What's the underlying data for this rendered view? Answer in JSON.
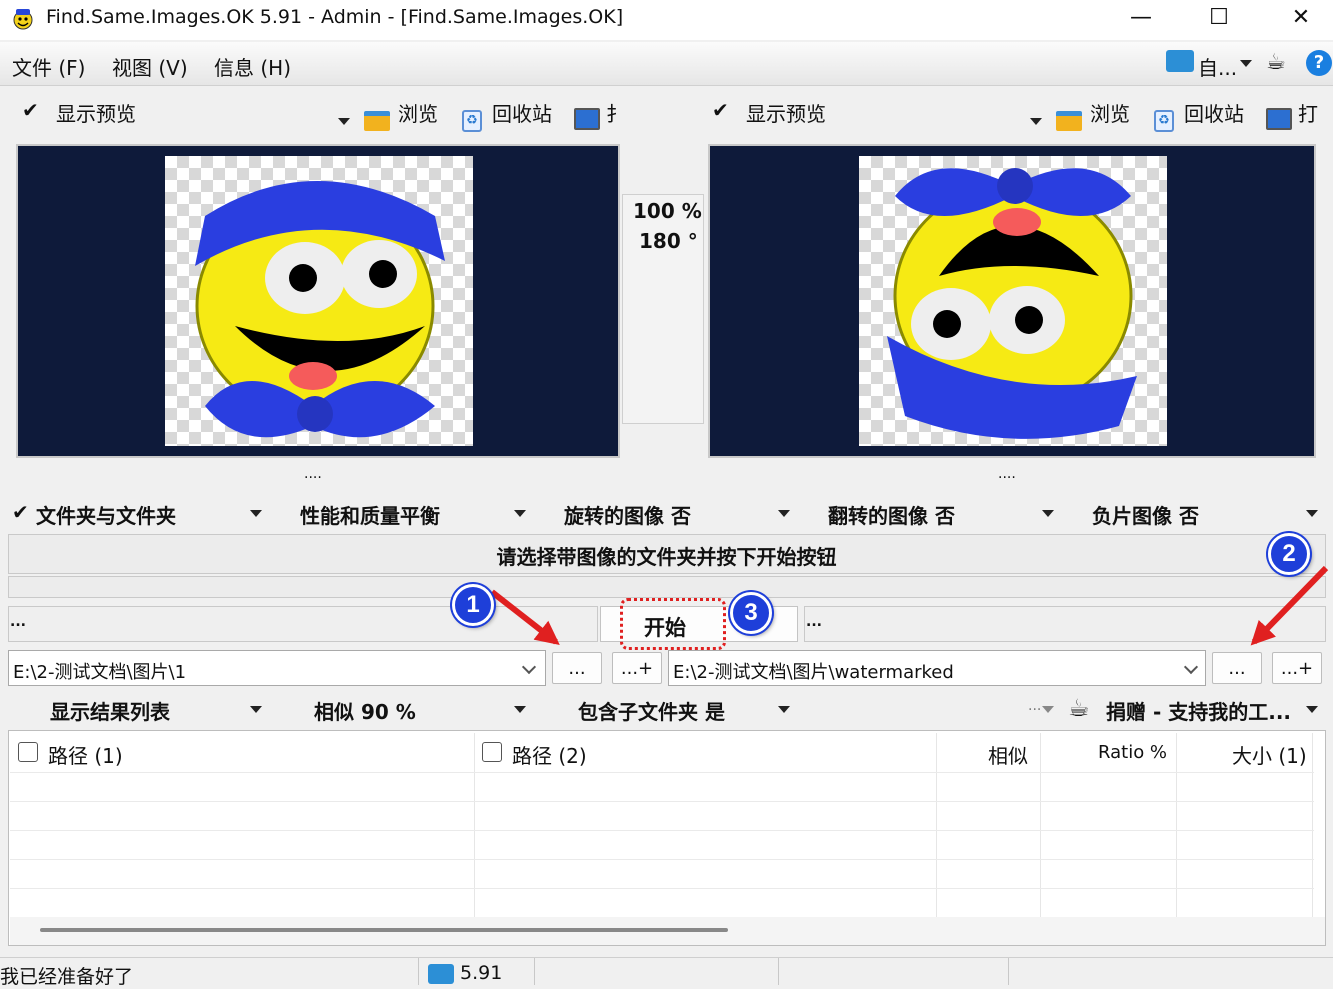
{
  "window": {
    "title": "Find.Same.Images.OK 5.91 - Admin - [Find.Same.Images.OK]",
    "minimize": "—",
    "maximize": "☐",
    "close": "✕"
  },
  "menu": {
    "items": [
      "文件 (F)",
      "视图 (V)",
      "信息 (H)"
    ],
    "right_label": "自..."
  },
  "left_toolbar": {
    "check": "✔",
    "preview_label": "显示预览",
    "browse": "浏览",
    "recycle": "回收站",
    "open": "扌"
  },
  "right_toolbar": {
    "check": "✔",
    "preview_label": "显示预览",
    "browse": "浏览",
    "recycle": "回收站",
    "open": "打"
  },
  "compare": {
    "percent": "100 %",
    "angle": "180 °"
  },
  "dots": "....",
  "options": {
    "check": "✔",
    "mode": "文件夹与文件夹",
    "balance": "性能和质量平衡",
    "rotated": "旋转的图像 否",
    "flipped": "翻转的图像 否",
    "negative": "负片图像 否"
  },
  "message": "请选择带图像的文件夹并按下开始按钮",
  "start_label": "开始",
  "left_status": "...",
  "right_status": "...",
  "left_path": "E:\\2-测试文档\\图片\\1",
  "right_path": "E:\\2-测试文档\\图片\\watermarked",
  "browse_btn": "...",
  "add_btn": "...+",
  "results_options": {
    "show": "显示结果列表",
    "similar": "相似 90 %",
    "subfolders": "包含子文件夹 是",
    "more": "...",
    "donate": "捐赠 - 支持我的工..."
  },
  "table": {
    "columns": [
      "路径 (1)",
      "路径 (2)",
      "相似",
      "Ratio %",
      "大小 (1)"
    ]
  },
  "annotations": [
    "1",
    "2",
    "3"
  ],
  "statusbar": {
    "left": "我已经准备好了",
    "version": "5.91"
  },
  "colors": {
    "panel_bg": "#0e1a3a",
    "annotation_blue": "#1e3fd9",
    "annotation_red": "#e02020"
  }
}
